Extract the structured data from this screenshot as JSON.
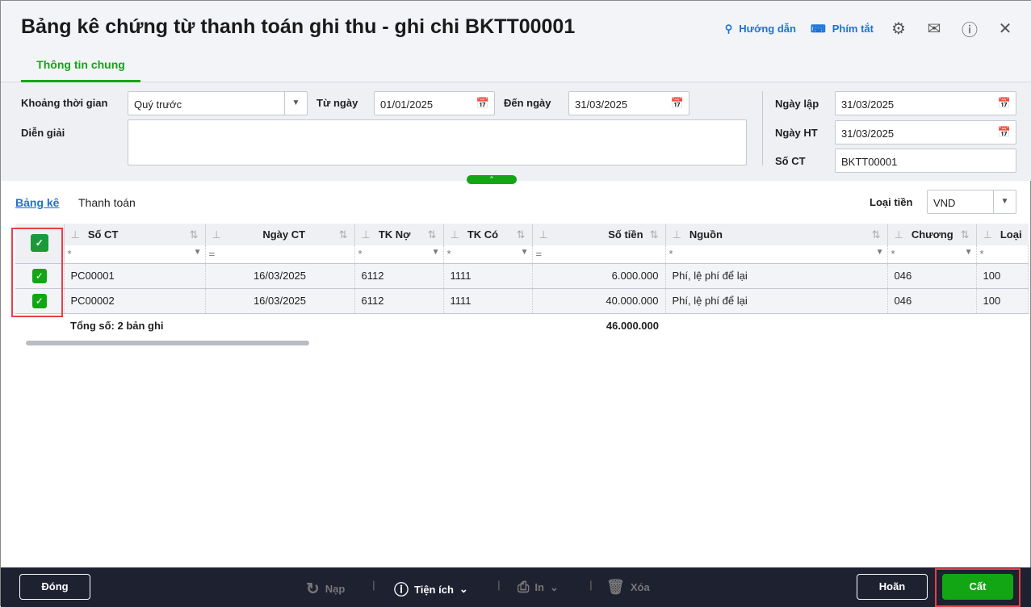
{
  "header": {
    "title": "Bảng kê chứng từ thanh toán ghi thu - ghi chi BKTT00001",
    "guide": "Hướng dẫn",
    "shortcuts": "Phím tắt",
    "tab": "Thông tin chung"
  },
  "form": {
    "period_label": "Khoảng thời gian",
    "period_value": "Quý trước",
    "from_label": "Từ ngày",
    "from_value": "01/01/2025",
    "to_label": "Đến ngày",
    "to_value": "31/03/2025",
    "desc_label": "Diễn giải",
    "desc_value": "",
    "created_label": "Ngày lập",
    "created_value": "31/03/2025",
    "posted_label": "Ngày HT",
    "posted_value": "31/03/2025",
    "docno_label": "Số CT",
    "docno_value": "BKTT00001"
  },
  "subtabs": [
    "Bảng kê",
    "Thanh toán"
  ],
  "currency": {
    "label": "Loại tiền",
    "value": "VND"
  },
  "grid": {
    "columns": [
      "Số CT",
      "Ngày CT",
      "TK Nợ",
      "TK Có",
      "Số tiền",
      "Nguồn",
      "Chương",
      "Loại"
    ],
    "filters": [
      "*",
      "=",
      "*",
      "*",
      "=",
      "*",
      "*",
      "*"
    ],
    "rows": [
      [
        "PC00001",
        "16/03/2025",
        "6112",
        "1111",
        "6.000.000",
        "Phí, lệ phí để lại",
        "046",
        "100"
      ],
      [
        "PC00002",
        "16/03/2025",
        "6112",
        "1111",
        "40.000.000",
        "Phí, lệ phí để lại",
        "046",
        "100"
      ]
    ],
    "total_label": "Tổng số: 2 bản ghi",
    "total_amount": "46.000.000"
  },
  "footer": {
    "close": "Đóng",
    "reload": "Nạp",
    "utilities": "Tiện ích",
    "print": "In",
    "delete": "Xóa",
    "cancel": "Hoãn",
    "save": "Cất"
  },
  "colors": {
    "accent": "#13a614",
    "link": "#1a73d8",
    "footer_bg": "#1e2130",
    "highlight": "#e8404a"
  }
}
